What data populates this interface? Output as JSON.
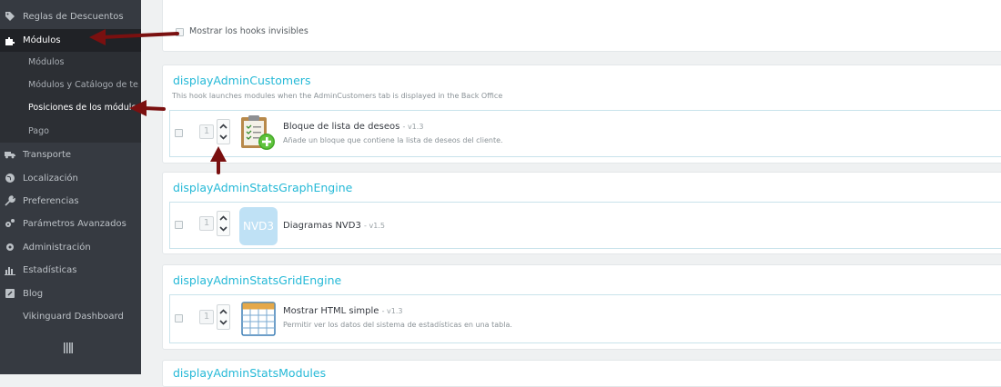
{
  "sidebar": {
    "items": [
      {
        "label": "Reglas de Descuentos",
        "icon": "tag-icon"
      },
      {
        "label": "Módulos",
        "icon": "puzzle-icon"
      },
      {
        "label": "Transporte",
        "icon": "truck-icon"
      },
      {
        "label": "Localización",
        "icon": "globe-icon"
      },
      {
        "label": "Preferencias",
        "icon": "wrench-icon"
      },
      {
        "label": "Parámetros Avanzados",
        "icon": "cogs-icon"
      },
      {
        "label": "Administración",
        "icon": "gear-icon"
      },
      {
        "label": "Estadísticas",
        "icon": "bar-chart-icon"
      },
      {
        "label": "Blog",
        "icon": "edit-icon"
      },
      {
        "label": "Vikinguard Dashboard",
        "icon": ""
      }
    ],
    "subitems": [
      {
        "label": "Módulos"
      },
      {
        "label": "Módulos y Catálogo de te..."
      },
      {
        "label": "Posiciones de los módulos"
      },
      {
        "label": "Pago"
      }
    ],
    "collapse_icon": "collapse-icon"
  },
  "filter": {
    "show_invisible_label": "Mostrar los hooks invisibles"
  },
  "hooks": [
    {
      "title": "displayAdminCustomers",
      "description": "This hook launches modules when the AdminCustomers tab is displayed in the Back Office",
      "module": {
        "position": "1",
        "name": "Bloque de lista de deseos",
        "version": "- v1.3",
        "description": "Añade un bloque que contiene la lista de deseos del cliente.",
        "icon": "wishlist-clipboard-icon"
      }
    },
    {
      "title": "displayAdminStatsGraphEngine",
      "description": "",
      "module": {
        "position": "1",
        "name": "Diagramas NVD3",
        "version": "- v1.5",
        "description": "",
        "logo_text": "NVD3",
        "icon": "nvd3-logo-icon"
      }
    },
    {
      "title": "displayAdminStatsGridEngine",
      "description": "",
      "module": {
        "position": "1",
        "name": "Mostrar HTML simple",
        "version": "- v1.3",
        "description": "Permitir ver los datos del sistema de estadísticas en una tabla.",
        "icon": "table-grid-icon"
      }
    },
    {
      "title": "displayAdminStatsModules"
    }
  ],
  "colors": {
    "sidebar_bg": "#363a41",
    "accent": "#25b9d7",
    "annotation_arrow": "#7a1010"
  }
}
